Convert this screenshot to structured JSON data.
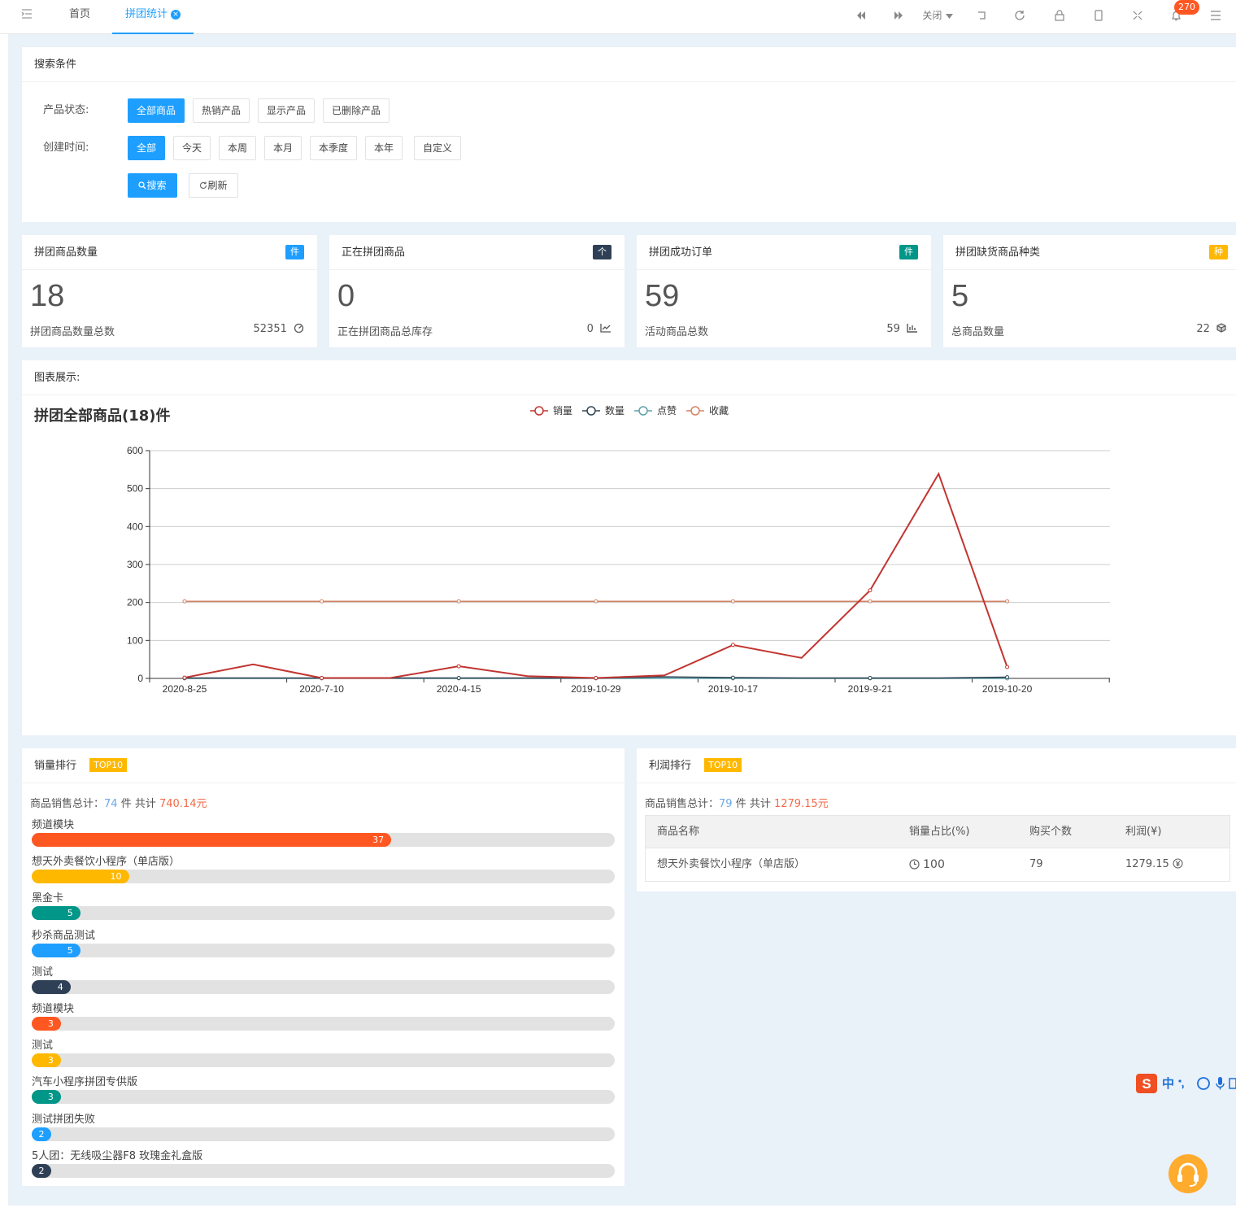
{
  "topbar": {
    "tabs": [
      {
        "label": "首页"
      },
      {
        "label": "拼团统计"
      }
    ],
    "close_label": "关闭",
    "notification_count": "270"
  },
  "search": {
    "title": "搜索条件",
    "status_label": "产品状态:",
    "status_options": [
      "全部商品",
      "热销产品",
      "显示产品",
      "已删除产品"
    ],
    "time_label": "创建时间:",
    "time_options": [
      "全部",
      "今天",
      "本周",
      "本月",
      "本季度",
      "本年",
      "自定义"
    ],
    "search_button": "搜索",
    "refresh_button": "刷新"
  },
  "stats": [
    {
      "title": "拼团商品数量",
      "badge": "件",
      "badge_color": "#1e9fff",
      "value": "18",
      "desc": "拼团商品数量总数",
      "right_value": "52351",
      "right_icon": "gauge-icon"
    },
    {
      "title": "正在拼团商品",
      "badge": "个",
      "badge_color": "#2f4056",
      "value": "0",
      "desc": "正在拼团商品总库存",
      "right_value": "0",
      "right_icon": "line-chart-icon"
    },
    {
      "title": "拼团成功订单",
      "badge": "件",
      "badge_color": "#009688",
      "value": "59",
      "desc": "活动商品总数",
      "right_value": "59",
      "right_icon": "bar-chart-icon"
    },
    {
      "title": "拼团缺货商品种类",
      "badge": "种",
      "badge_color": "#ffb800",
      "value": "5",
      "desc": "总商品数量",
      "right_value": "22",
      "right_icon": "cube-icon"
    }
  ],
  "chart_panel": {
    "title": "图表展示:"
  },
  "chart_data": {
    "type": "line",
    "title": "拼团全部商品(18)件",
    "x": [
      "2020-8-25",
      "",
      "2020-7-10",
      "",
      "2020-4-15",
      "",
      "2019-10-29",
      "",
      "2019-10-17",
      "",
      "2019-9-21",
      "",
      "2019-10-20",
      ""
    ],
    "x_tick_labels": [
      "2020-8-25",
      "2020-7-10",
      "2020-4-15",
      "2019-10-29",
      "2019-10-17",
      "2019-9-21",
      "2019-10-20"
    ],
    "ylim": [
      0,
      600
    ],
    "y_ticks": [
      0,
      100,
      200,
      300,
      400,
      500,
      600
    ],
    "grid": true,
    "legend_position": "top-center",
    "series": [
      {
        "name": "销量",
        "color": "#c23531",
        "values": [
          2,
          37,
          1,
          1,
          32,
          6,
          1,
          8,
          88,
          54,
          232,
          539,
          30
        ]
      },
      {
        "name": "数量",
        "color": "#2f4554",
        "values": [
          1,
          1,
          1,
          1,
          1,
          1,
          1,
          4,
          2,
          1,
          1,
          1,
          3
        ]
      },
      {
        "name": "点赞",
        "color": "#61a0a8",
        "values": [
          0,
          0,
          0,
          0,
          0,
          0,
          0,
          0,
          0,
          0,
          0,
          0,
          0
        ]
      },
      {
        "name": "收藏",
        "color": "#d48265",
        "values": [
          203,
          203,
          203,
          203,
          203,
          203,
          203,
          203,
          203,
          203,
          203,
          203,
          203
        ]
      }
    ]
  },
  "sales_rank": {
    "title": "销量排行",
    "tag": "TOP10",
    "summary_prefix": "商品销售总计：",
    "summary_count": "74",
    "summary_mid": "件 共计",
    "summary_amount": "740.14元",
    "max": 60,
    "items": [
      {
        "name": "频道模块",
        "value": 37,
        "color": "#ff5722"
      },
      {
        "name": "想天外卖餐饮小程序（单店版）",
        "value": 10,
        "color": "#ffb800"
      },
      {
        "name": "黑金卡",
        "value": 5,
        "color": "#009688"
      },
      {
        "name": "秒杀商品测试",
        "value": 5,
        "color": "#1e9fff"
      },
      {
        "name": "测试",
        "value": 4,
        "color": "#2f4056"
      },
      {
        "name": "频道模块",
        "value": 3,
        "color": "#ff5722"
      },
      {
        "name": "测试",
        "value": 3,
        "color": "#ffb800"
      },
      {
        "name": "汽车小程序拼团专供版",
        "value": 3,
        "color": "#009688"
      },
      {
        "name": "测试拼团失败",
        "value": 2,
        "color": "#1e9fff"
      },
      {
        "name": "5人团：无线吸尘器F8 玫瑰金礼盒版",
        "value": 2,
        "color": "#2f4056"
      }
    ]
  },
  "profit_rank": {
    "title": "利润排行",
    "tag": "TOP10",
    "summary_prefix": "商品销售总计：",
    "summary_count": "79",
    "summary_mid": "件 共计",
    "summary_amount": "1279.15元",
    "columns": [
      "商品名称",
      "销量占比(%)",
      "购买个数",
      "利润(¥)"
    ],
    "rows": [
      {
        "name": "想天外卖餐饮小程序（单店版）",
        "ratio": "100",
        "count": "79",
        "profit": "1279.15"
      }
    ]
  },
  "ime": {
    "label": "中"
  }
}
